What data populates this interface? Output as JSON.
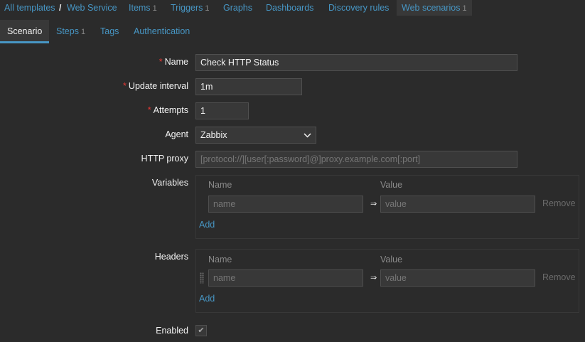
{
  "nav": {
    "all_templates": "All templates",
    "template_name": "Web Service",
    "items": {
      "label": "Items",
      "count": "1"
    },
    "triggers": {
      "label": "Triggers",
      "count": "1"
    },
    "graphs": "Graphs",
    "dashboards": "Dashboards",
    "discovery": "Discovery rules",
    "web_scenarios": {
      "label": "Web scenarios",
      "count": "1"
    }
  },
  "tabs": {
    "scenario": "Scenario",
    "steps": {
      "label": "Steps",
      "count": "1"
    },
    "tags": "Tags",
    "authentication": "Authentication"
  },
  "form": {
    "name": {
      "label": "Name",
      "value": "Check HTTP Status"
    },
    "update_interval": {
      "label": "Update interval",
      "value": "1m"
    },
    "attempts": {
      "label": "Attempts",
      "value": "1"
    },
    "agent": {
      "label": "Agent",
      "value": "Zabbix"
    },
    "http_proxy": {
      "label": "HTTP proxy",
      "placeholder": "[protocol://][user[:password]@]proxy.example.com[:port]"
    },
    "variables": {
      "label": "Variables",
      "col_name": "Name",
      "col_value": "Value",
      "name_placeholder": "name",
      "value_placeholder": "value",
      "arrow": "⇒",
      "remove": "Remove",
      "add": "Add"
    },
    "headers": {
      "label": "Headers",
      "col_name": "Name",
      "col_value": "Value",
      "name_placeholder": "name",
      "value_placeholder": "value",
      "arrow": "⇒",
      "remove": "Remove",
      "add": "Add"
    },
    "enabled": {
      "label": "Enabled",
      "checked": true,
      "check_glyph": "✔"
    }
  },
  "required_mark": "*",
  "colors": {
    "background": "#2b2b2b",
    "field_bg": "#383838",
    "link": "#4796c4",
    "required": "#e33734"
  }
}
